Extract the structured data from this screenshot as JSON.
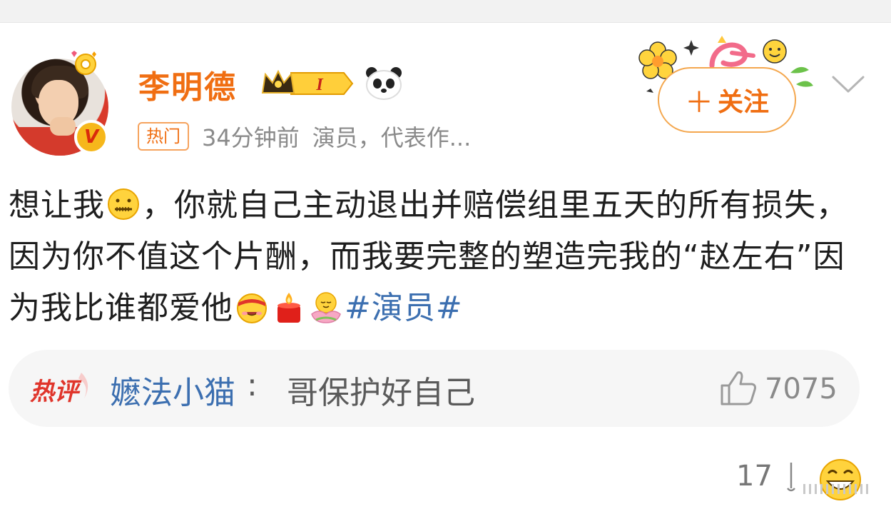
{
  "header": {
    "username": "李明德",
    "hot_tag": "热门",
    "time": "34分钟前",
    "bio": "演员，代表作...",
    "follow_label": "关注"
  },
  "post": {
    "segments": [
      {
        "type": "text",
        "value": "想让我"
      },
      {
        "type": "emoji",
        "name": "zipper-mouth-emoji"
      },
      {
        "type": "text",
        "value": "，你就自己主动退出并赔偿组里五天的所有损失，因为你不值这个片酬，而我要完整的塑造完我的“赵左右”因为我比谁都爱他"
      },
      {
        "type": "emoji",
        "name": "headband-face-emoji"
      },
      {
        "type": "emoji",
        "name": "candle-emoji"
      },
      {
        "type": "emoji",
        "name": "lotus-face-emoji"
      },
      {
        "type": "hashtag",
        "value": "#演员#"
      }
    ]
  },
  "hot_comment": {
    "label": "热评",
    "user": "嬷法小猫",
    "separator": ":",
    "text": "哥保护好自己",
    "likes": "7075"
  },
  "bottom": {
    "count": "17"
  },
  "colors": {
    "accent": "#f06e12",
    "link": "#3c6fb0",
    "muted": "#8a8a8a",
    "comment_bg": "#f6f6f6",
    "hot_label": "#e0352b"
  }
}
